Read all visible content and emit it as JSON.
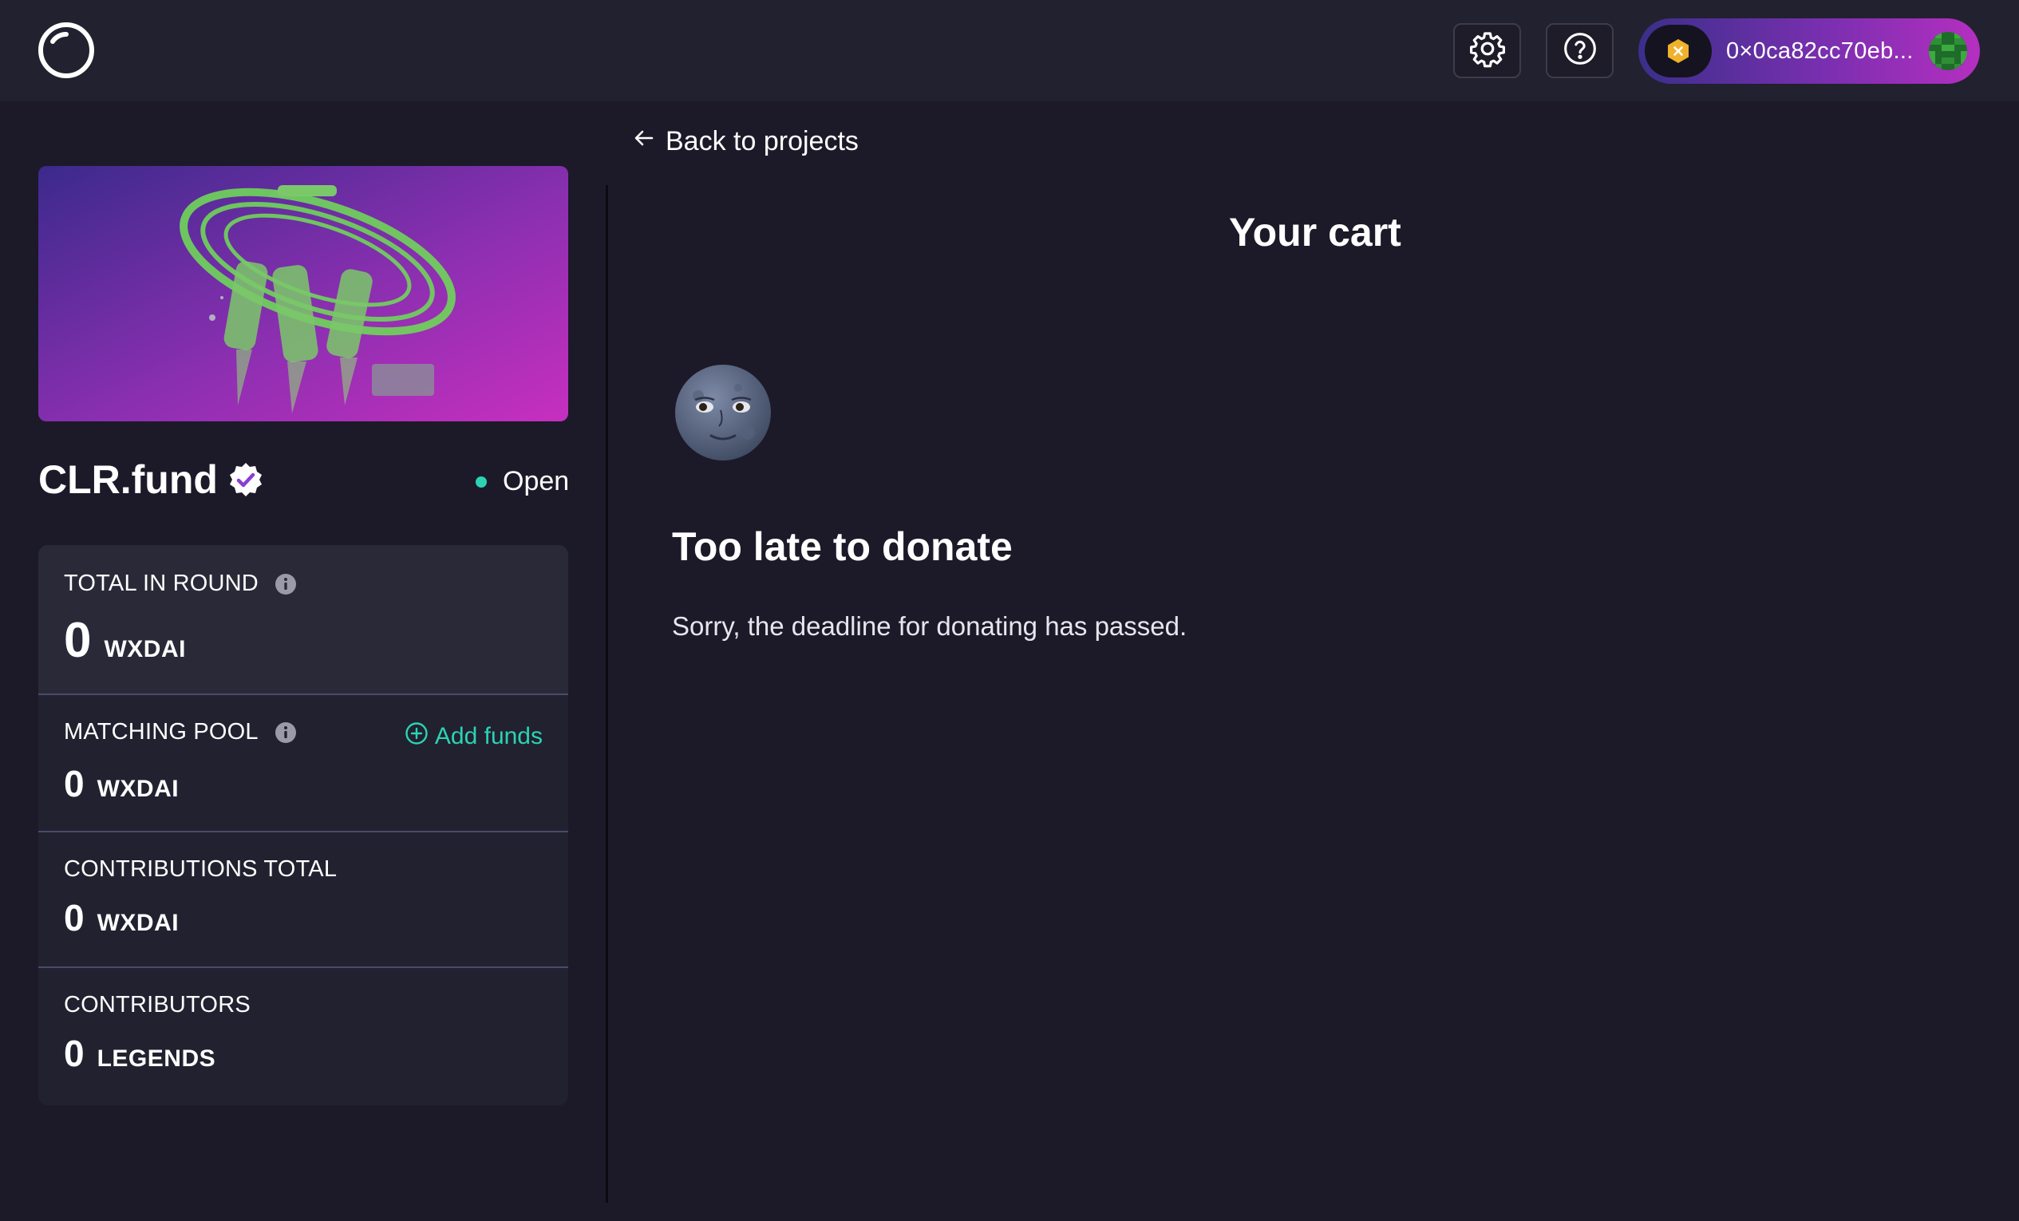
{
  "header": {
    "wallet_address": "0×0ca82cc70eb..."
  },
  "nav": {
    "back_label": "Back to projects"
  },
  "project": {
    "name": "CLR.fund",
    "status": "Open"
  },
  "stats": {
    "total_in_round": {
      "label": "TOTAL IN ROUND",
      "value": "0",
      "unit": "WXDAI"
    },
    "matching_pool": {
      "label": "MATCHING POOL",
      "value": "0",
      "unit": "WXDAI",
      "action": "Add funds"
    },
    "contributions_total": {
      "label": "CONTRIBUTIONS TOTAL",
      "value": "0",
      "unit": "WXDAI"
    },
    "contributors": {
      "label": "CONTRIBUTORS",
      "value": "0",
      "unit": "LEGENDS"
    }
  },
  "cart": {
    "title": "Your cart",
    "message_title": "Too late to donate",
    "message_text": "Sorry, the deadline for donating has passed."
  },
  "colors": {
    "accent": "#2bd3b4",
    "background": "#1c1a28",
    "topbar": "#22212f",
    "panel": "#222130",
    "wallet_gradient_start": "#3a2f8a",
    "wallet_gradient_end": "#b52fc0"
  },
  "icons": [
    "logo-icon",
    "gear-icon",
    "question-icon",
    "chain-badge-icon",
    "wallet-avatar-icon",
    "verified-badge-icon",
    "info-icon",
    "plus-circle-icon",
    "arrow-left-icon",
    "moon-face-icon"
  ]
}
